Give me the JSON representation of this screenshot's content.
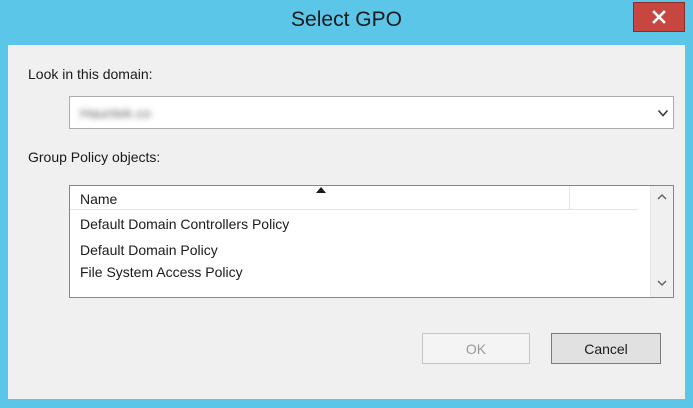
{
  "window": {
    "title": "Select GPO",
    "close_glyph": "x"
  },
  "domain": {
    "label": "Look in this domain:",
    "selected_value": "Hauntek.co"
  },
  "gpo_list": {
    "label": "Group Policy objects:",
    "column_header": "Name",
    "items": [
      "Default Domain Controllers Policy",
      "Default Domain Policy",
      "File System Access Policy"
    ]
  },
  "buttons": {
    "ok": "OK",
    "cancel": "Cancel"
  },
  "colors": {
    "window_frame": "#5bc6e8",
    "close_button": "#c7463f",
    "client_background": "#f0f0f0"
  }
}
